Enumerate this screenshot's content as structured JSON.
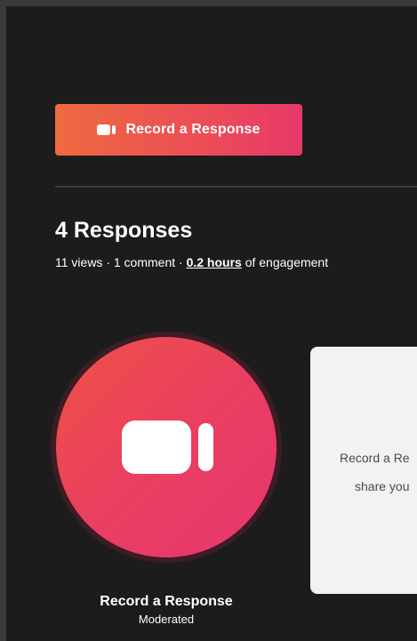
{
  "colors": {
    "background": "#1c1c1c",
    "accent_start": "#ee6a3f",
    "accent_end": "#e8386a",
    "card_background": "#f2f2f2"
  },
  "header": {
    "record_button_label": "Record a Response",
    "record_button_icon": "video-camera-icon"
  },
  "responses": {
    "title": "4 Responses",
    "stats_prefix": "11 views · 1 comment · ",
    "engagement_hours": "0.2 hours",
    "stats_suffix": " of engagement"
  },
  "record_tile": {
    "icon": "video-camera-icon",
    "title": "Record a Response",
    "subtitle": "Moderated"
  },
  "info_card": {
    "line1": "Record a Re",
    "line2": "share you"
  }
}
